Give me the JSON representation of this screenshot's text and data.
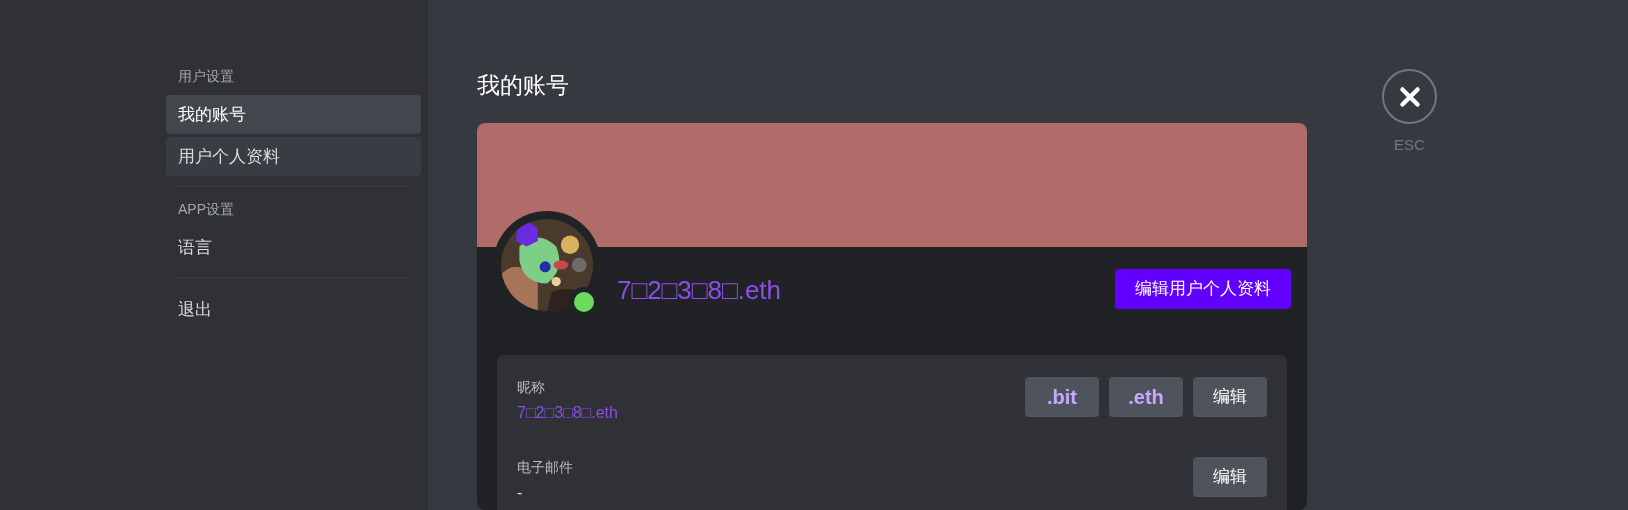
{
  "sidebar": {
    "sections": [
      {
        "heading": "用户设置",
        "items": [
          {
            "label": "我的账号",
            "selected": true
          },
          {
            "label": "用户个人资料",
            "selected": false
          }
        ]
      },
      {
        "heading": "APP设置",
        "items": [
          {
            "label": "语言",
            "selected": false
          }
        ]
      },
      {
        "items": [
          {
            "label": "退出",
            "selected": false
          }
        ]
      }
    ]
  },
  "page_title": "我的账号",
  "profile": {
    "name": "7□2□3□8□.eth",
    "online": true,
    "edit_button": "编辑用户个人资料"
  },
  "fields": [
    {
      "label": "昵称",
      "value": "7□2□3□8□.eth",
      "accent": true,
      "badges": [
        ".bit",
        ".eth"
      ],
      "button": "编辑"
    },
    {
      "label": "电子邮件",
      "value": "-",
      "accent": false,
      "button": "编辑"
    }
  ],
  "close": {
    "label": "ESC"
  }
}
